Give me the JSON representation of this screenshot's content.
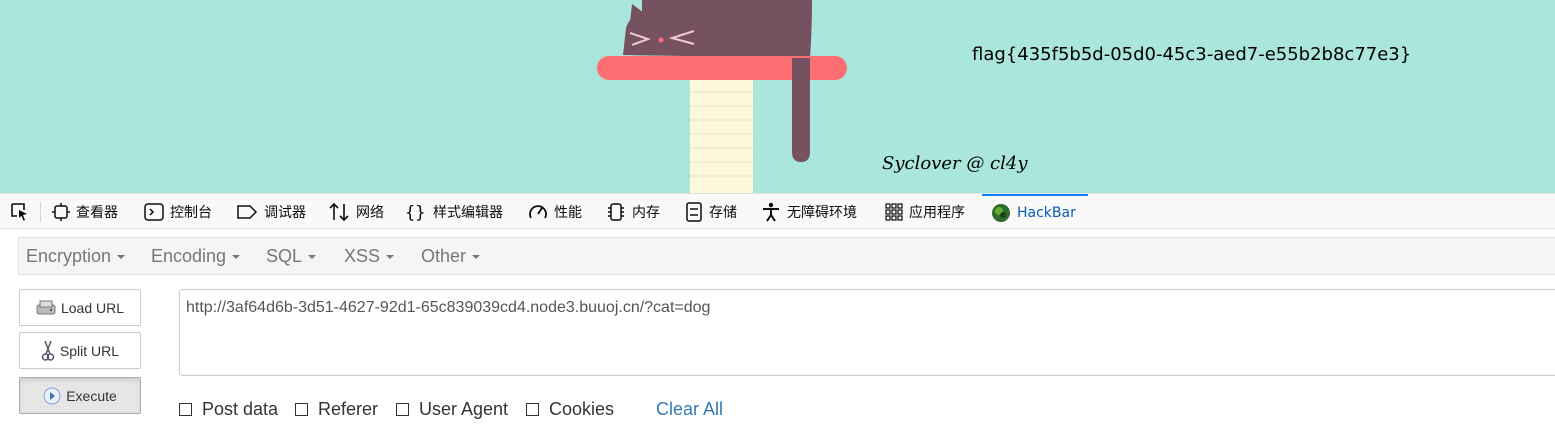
{
  "page": {
    "flag_text": "flag{435f5b5d-05d0-45c3-aed7-e55b2b8c77e3}",
    "signature": "Syclover @ cl4y",
    "background_color": "#abe6dc"
  },
  "devtools": {
    "tools": [
      {
        "label": "查看器",
        "icon": "inspector-icon"
      },
      {
        "label": "控制台",
        "icon": "console-icon"
      },
      {
        "label": "调试器",
        "icon": "debugger-icon"
      },
      {
        "label": "网络",
        "icon": "network-icon"
      },
      {
        "label": "样式编辑器",
        "icon": "style-editor-icon"
      },
      {
        "label": "性能",
        "icon": "performance-icon"
      },
      {
        "label": "内存",
        "icon": "memory-icon"
      },
      {
        "label": "存储",
        "icon": "storage-icon"
      },
      {
        "label": "无障碍环境",
        "icon": "accessibility-icon"
      },
      {
        "label": "应用程序",
        "icon": "application-icon"
      },
      {
        "label": "HackBar",
        "icon": "hackbar-icon",
        "active": true
      }
    ]
  },
  "hackbar": {
    "menus": [
      "Encryption",
      "Encoding",
      "SQL",
      "XSS",
      "Other"
    ],
    "buttons": {
      "load_url": "Load URL",
      "split_url": "Split URL",
      "execute": "Execute"
    },
    "url_value": "http://3af64d6b-3d51-4627-92d1-65c839039cd4.node3.buuoj.cn/?cat=dog",
    "options": [
      {
        "label": "Post data",
        "checked": false
      },
      {
        "label": "Referer",
        "checked": false
      },
      {
        "label": "User Agent",
        "checked": false
      },
      {
        "label": "Cookies",
        "checked": false
      }
    ],
    "clear_all": "Clear All"
  }
}
